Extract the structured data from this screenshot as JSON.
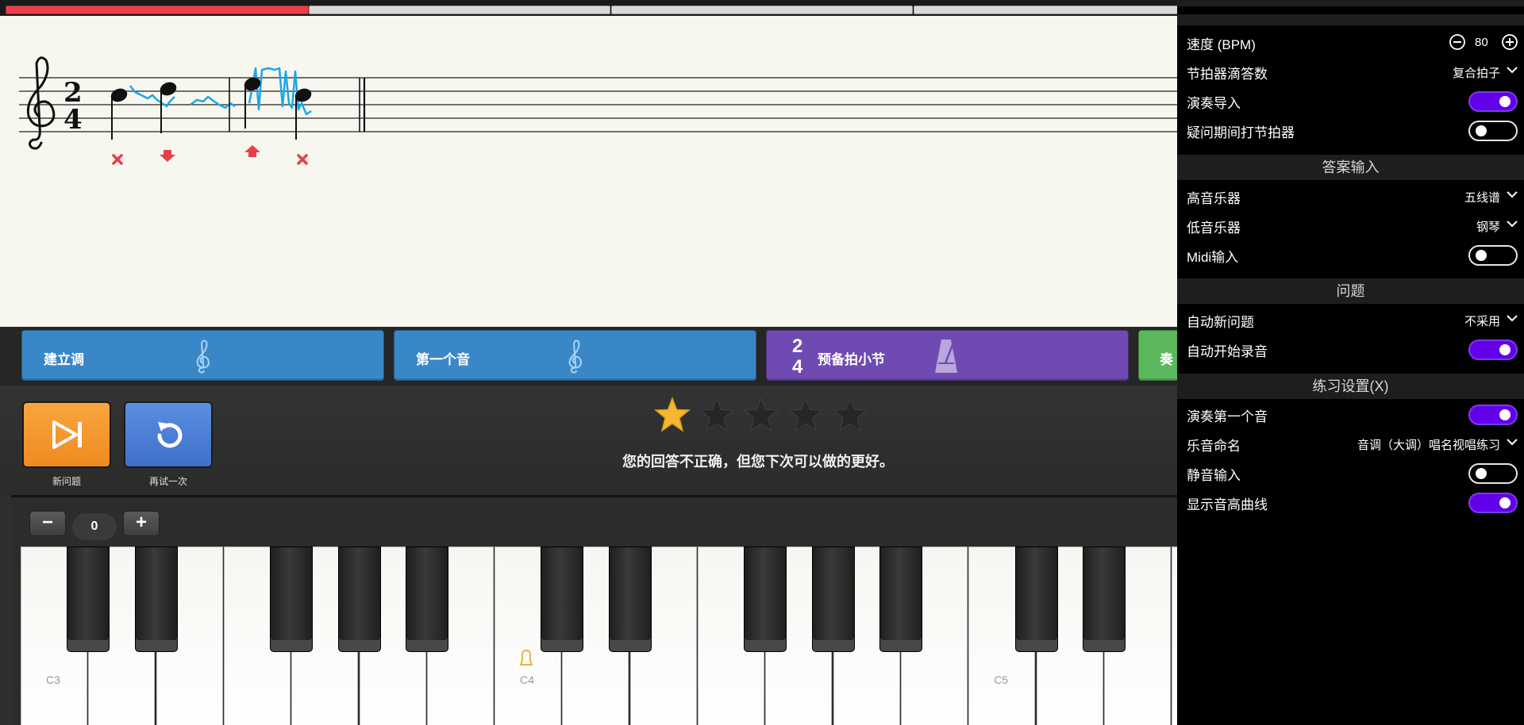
{
  "steps": {
    "establish_key": "建立调",
    "first_note": "第一个音",
    "count_in_bar": "预备拍小节",
    "count_in_top": "2",
    "count_in_bottom": "4",
    "play_partial": "奏"
  },
  "controls": {
    "new_question": "新问题",
    "retry": "再试一次",
    "rating": 1,
    "rating_max": 5,
    "feedback": "您的回答不正确，但您下次可以做的更好。"
  },
  "octave": {
    "value": "0",
    "minus": "−",
    "plus": "+"
  },
  "piano": {
    "labels": [
      "C3",
      "C4",
      "C5"
    ]
  },
  "settings": {
    "tempo_label": "速度 (BPM)",
    "tempo_value": "80",
    "metronome_label": "节拍器滴答数",
    "metronome_value": "复合拍子",
    "play_intro_label": "演奏导入",
    "play_intro_on": true,
    "metro_during_label": "疑问期间打节拍器",
    "metro_during_on": false,
    "section_answer": "答案输入",
    "treble_label": "高音乐器",
    "treble_value": "五线谱",
    "bass_label": "低音乐器",
    "bass_value": "钢琴",
    "midi_label": "Midi输入",
    "midi_on": false,
    "section_question": "问题",
    "auto_new_label": "自动新问题",
    "auto_new_value": "不采用",
    "auto_record_label": "自动开始录音",
    "auto_record_on": true,
    "section_practice": "练习设置(X)",
    "play_first_label": "演奏第一个音",
    "play_first_on": true,
    "naming_label": "乐音命名",
    "naming_value": "音调（大调）唱名视唱练习",
    "mute_label": "静音输入",
    "mute_on": false,
    "pitch_curve_label": "显示音高曲线",
    "pitch_curve_on": true
  },
  "colors": {
    "progress_active": "#e8404a",
    "step_blue": "#3a87c8",
    "step_purple": "#6f4ab3",
    "step_green": "#5cb85c",
    "btn_orange": "#f5962a",
    "btn_blue": "#4a7fd6",
    "toggle_on": "#6200ea",
    "pitch_curve": "#1aa7e8",
    "mark_red": "#e5404a",
    "star_gold": "#f5b731"
  }
}
